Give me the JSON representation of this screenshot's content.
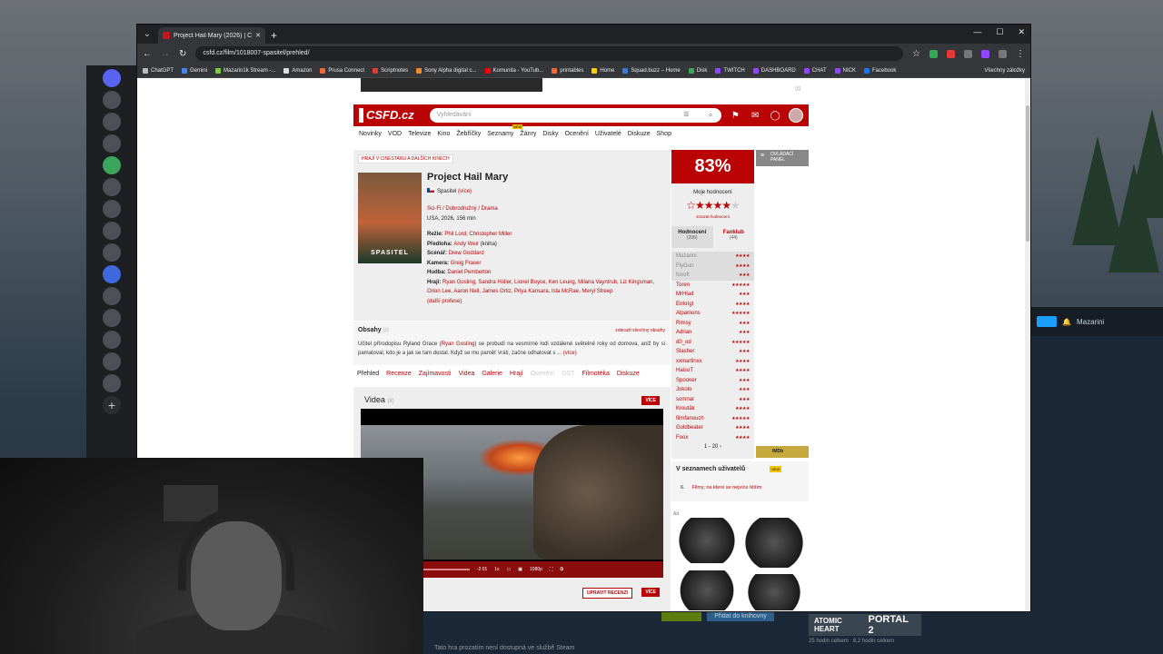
{
  "browser": {
    "tab_title": "Project Hail Mary (2026) | ČSFD",
    "url": "csfd.cz/film/1018007-spasitel/prehled/",
    "bookmarks": [
      {
        "label": "ChatGPT",
        "color": "#bbbbbb"
      },
      {
        "label": "Gemini",
        "color": "#4285f4"
      },
      {
        "label": "Mazarin1k Stream -...",
        "color": "#7ccf3c"
      },
      {
        "label": "Amazon",
        "color": "#dddddd"
      },
      {
        "label": "Prusa Connect",
        "color": "#fa6831"
      },
      {
        "label": "Scriptnotes",
        "color": "#e03c31"
      },
      {
        "label": "Sony Alpha digital c...",
        "color": "#f08a24"
      },
      {
        "label": "Komunita - YouTub...",
        "color": "#ff0000"
      },
      {
        "label": "printables",
        "color": "#fa6831"
      },
      {
        "label": "Home",
        "color": "#ffcc00"
      },
      {
        "label": "Squad.buzz – Home",
        "color": "#3a7bd5"
      },
      {
        "label": "Disk",
        "color": "#34a853"
      },
      {
        "label": "TWITCH",
        "color": "#9146ff"
      },
      {
        "label": "DASHBOARD",
        "color": "#9146ff"
      },
      {
        "label": "CHAT",
        "color": "#9146ff"
      },
      {
        "label": "NICK",
        "color": "#9146ff"
      },
      {
        "label": "Facebook",
        "color": "#1877f2"
      }
    ],
    "bookmarks_all": "Všechny záložky"
  },
  "csfd": {
    "logo": "CSFD.cz",
    "search_placeholder": "Vyhledávání",
    "nav": [
      "Novinky",
      "VOD",
      "Televize",
      "Kino",
      "Žebříčky",
      "Seznamy",
      "Žánry",
      "Disky",
      "Ocenění",
      "Uživatelé",
      "Diskuze",
      "Shop"
    ],
    "cinema_tag": "HRAJÍ V CINESTARU A DALŠÍCH KINECH",
    "poster_text": "SPASITEL",
    "title": "Project Hail Mary",
    "alt_title": "Spasitel",
    "alt_more": "(více)",
    "genre": "Sci-Fi / Dobrodružný / Drama",
    "origin": "USA, 2026, 156 min",
    "credits": [
      {
        "label": "Režie:",
        "names": "Phil Lord, Christopher Miller"
      },
      {
        "label": "Předloha:",
        "names": "Andy Weir",
        "extra": " (kniha)"
      },
      {
        "label": "Scénář:",
        "names": "Drew Goddard"
      },
      {
        "label": "Kamera:",
        "names": "Greig Fraser"
      },
      {
        "label": "Hudba:",
        "names": "Daniel Pemberton"
      },
      {
        "label": "Hrají:",
        "names": "Ryan Gosling, Sandra Hüller, Lionel Boyce, Ken Leung, Milana Vayntrub, Liz Kingsman, Orion Lee, Aaron Neil, James Ortiz, Priya Kansara, Isla McRae, Meryl Streep"
      }
    ],
    "more_professions": "(další profese)",
    "plot_heading": "Obsahy",
    "plot_count": "(2)",
    "plot_all": "zobrazit všechny obsahy",
    "plot_text_a": "Učitel přírodopisu Ryland Grace (",
    "plot_actor": "Ryan Gosling",
    "plot_text_b": ") se probudí na vesmírné lodi vzdálené světelné roky od domova, aniž by si pamatoval, kdo je a jak se tam dostal. Když se mu paměť vrátí, začne odhalovat s ... ",
    "plot_more": "(více)",
    "film_tabs": [
      "Přehled",
      "Recenze",
      "Zajímavosti",
      "Videa",
      "Galerie",
      "Hrají",
      "Ocenění",
      "OST",
      "Filmotéka",
      "Diskuze"
    ],
    "video_heading": "Videa",
    "video_count": "(8)",
    "more_btn": "VÍCE",
    "player_time": "-2:01",
    "player_speed": "1x",
    "player_quality": "1080p",
    "edit_review": "UPRAVIT RECENZI",
    "score": "83%",
    "my_rating_label": "Moje hodnocení",
    "my_rating_stars": 4,
    "delete_rating": "smazat hodnocení",
    "rating_tabs": [
      {
        "label": "Hodnocení",
        "count": "(206)"
      },
      {
        "label": "Fanklub",
        "count": "(44)"
      }
    ],
    "raters": [
      {
        "name": "Mazarini",
        "stars": 4
      },
      {
        "name": "FlyGun",
        "stars": 4
      },
      {
        "name": "fuxoft",
        "stars": 3
      },
      {
        "name": "Toren",
        "stars": 5
      },
      {
        "name": "MrHlad",
        "stars": 3
      },
      {
        "name": "Errkrigl",
        "stars": 4
      },
      {
        "name": "Alpamons",
        "stars": 5
      },
      {
        "name": "Rimsy",
        "stars": 3
      },
      {
        "name": "Adrian",
        "stars": 3
      },
      {
        "name": "d0_od",
        "stars": 5
      },
      {
        "name": "Slasher",
        "stars": 3
      },
      {
        "name": "xxmartinxx",
        "stars": 4
      },
      {
        "name": "HaisoT",
        "stars": 4
      },
      {
        "name": "Spooner",
        "stars": 3
      },
      {
        "name": "Jokolo",
        "stars": 3
      },
      {
        "name": "somnar",
        "stars": 3
      },
      {
        "name": "Kroutäk",
        "stars": 4
      },
      {
        "name": "filmfanouch",
        "stars": 5
      },
      {
        "name": "Goldbeater",
        "stars": 4
      },
      {
        "name": "Foox",
        "stars": 4
      }
    ],
    "pager": "1 - 20",
    "control_panel": "OVLÁDACÍ PANEL",
    "imdb": "IMDb",
    "lists_heading": "V seznamech uživatelů",
    "lists_new": "NEW",
    "list_num": "6.",
    "list_name": "Filmy, na které se nejvíce těším",
    "ad_label": "Ad"
  },
  "steam": {
    "notice": "Tato hra prozatím není dostupná ve službě Steam",
    "wishlist": "Přidat do knihovny",
    "tile_a": "ATOMIC HEART",
    "tile_b": "PORTAL 2",
    "user": "Mazarini",
    "status_a": "25 hodin celkem",
    "status_b": "8,2 hodin celkem"
  },
  "colors": {
    "csfd_red": "#ba0305",
    "chrome_dark": "#202124",
    "steam_bg": "#1b2838",
    "imdb": "#c6a93c"
  }
}
